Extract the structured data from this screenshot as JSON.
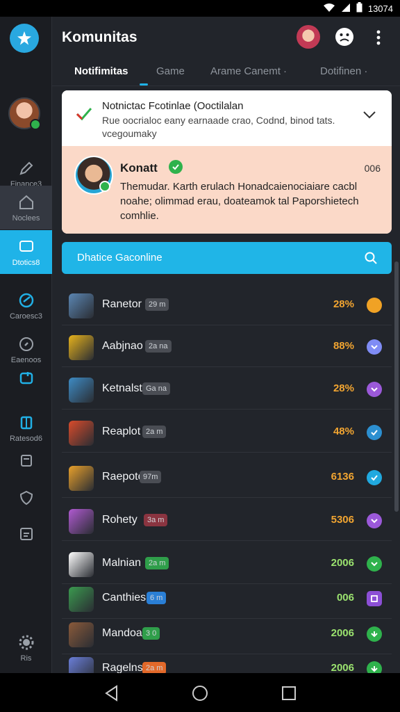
{
  "status_bar": {
    "time": "13074"
  },
  "app": {
    "title": "Komunitas"
  },
  "rail": {
    "items": [
      {
        "label": "Finance3",
        "icon": "pen-icon"
      },
      {
        "label": "Noclees",
        "icon": "home-icon"
      },
      {
        "label": "Dtotics8",
        "icon": "chat-icon"
      },
      {
        "label": "Caroesc3",
        "icon": "swirl-icon"
      },
      {
        "label": "Eaenoos",
        "icon": "compass-icon"
      },
      {
        "label": "",
        "icon": "chart-icon"
      },
      {
        "label": "Ratesod6",
        "icon": "book-icon"
      },
      {
        "label": "",
        "icon": "inbox-icon"
      },
      {
        "label": "",
        "icon": "shield-icon"
      },
      {
        "label": "",
        "icon": "list-icon"
      },
      {
        "label": "Ris",
        "icon": "gear-icon"
      }
    ]
  },
  "tabs": [
    {
      "label": "Notifimitas"
    },
    {
      "label": "Game"
    },
    {
      "label": "Arame Canemt ·"
    },
    {
      "label": "Dotifinen ·"
    }
  ],
  "notification": {
    "header_title": "Notnictac Fcotinlae (Ooctilalan",
    "header_desc": "Rue oocrialoc eany earnaade crao, Codnd, binod tats. vcegoumaky",
    "user_name": "Konatt",
    "time": "006",
    "message": "Themudar. Karth erulach Honadcaienociaiare cacbl noahe; olimmad erau, doateamok tal Paporshietech comhlie."
  },
  "search": {
    "label": "Dhatice Gaconline"
  },
  "games": [
    {
      "name": "Ranetor",
      "tag": "29 m",
      "tag_color": "#4a4d54",
      "percent": "28%",
      "pct_color": "#f2a531",
      "status_color": "#f0a225",
      "status_shape": "dot",
      "icon_bg": "#5b86b3"
    },
    {
      "name": "Aabjnao",
      "tag": "2a na",
      "tag_color": "#4a4d54",
      "percent": "88%",
      "pct_color": "#f2a531",
      "status_color": "#7f8cf5",
      "status_shape": "chevron",
      "icon_bg": "#e6b21c"
    },
    {
      "name": "Ketnalst",
      "tag": "Ga na",
      "tag_color": "#4a4d54",
      "percent": "28%",
      "pct_color": "#f2a531",
      "status_color": "#9b59d9",
      "status_shape": "chevron",
      "icon_bg": "#3e8bc4"
    },
    {
      "name": "Reaplot",
      "tag": "2a m",
      "tag_color": "#4a4d54",
      "percent": "48%",
      "pct_color": "#f2a531",
      "status_color": "#2c8fd0",
      "status_shape": "check",
      "icon_bg": "#d94b2b"
    },
    {
      "name": "Raepoto",
      "tag": "97m",
      "tag_color": "#4a4d54",
      "percent": "6136",
      "pct_color": "#f2a531",
      "status_color": "#20a9df",
      "status_shape": "check",
      "icon_bg": "#e8a02b"
    },
    {
      "name": "Rohety",
      "tag": "3a m",
      "tag_color": "#8a3440",
      "percent": "5306",
      "pct_color": "#f2a531",
      "status_color": "#9b59d9",
      "status_shape": "chevron",
      "icon_bg": "#b05ad1"
    },
    {
      "name": "Malnian",
      "tag": "2a m",
      "tag_color": "#2f9e4a",
      "percent": "2006",
      "pct_color": "#9be36f",
      "status_color": "#2fb24c",
      "status_shape": "chevron",
      "icon_bg": "#ffffff"
    },
    {
      "name": "Canthies",
      "tag": "6 m",
      "tag_color": "#2a7fd6",
      "percent": "006",
      "pct_color": "#9be36f",
      "status_color": "#8c4fd6",
      "status_shape": "square",
      "icon_bg": "#3b9a4f"
    },
    {
      "name": "Mandoas",
      "tag": "3 0",
      "tag_color": "#2f9e4a",
      "percent": "2006",
      "pct_color": "#9be36f",
      "status_color": "#2fb24c",
      "status_shape": "down",
      "icon_bg": "#8a5a3a"
    },
    {
      "name": "Ragelns",
      "tag": "2a m",
      "tag_color": "#e2692a",
      "percent": "2006",
      "pct_color": "#9be36f",
      "status_color": "#2fb24c",
      "status_shape": "down",
      "icon_bg": "#6a7ed9"
    }
  ]
}
